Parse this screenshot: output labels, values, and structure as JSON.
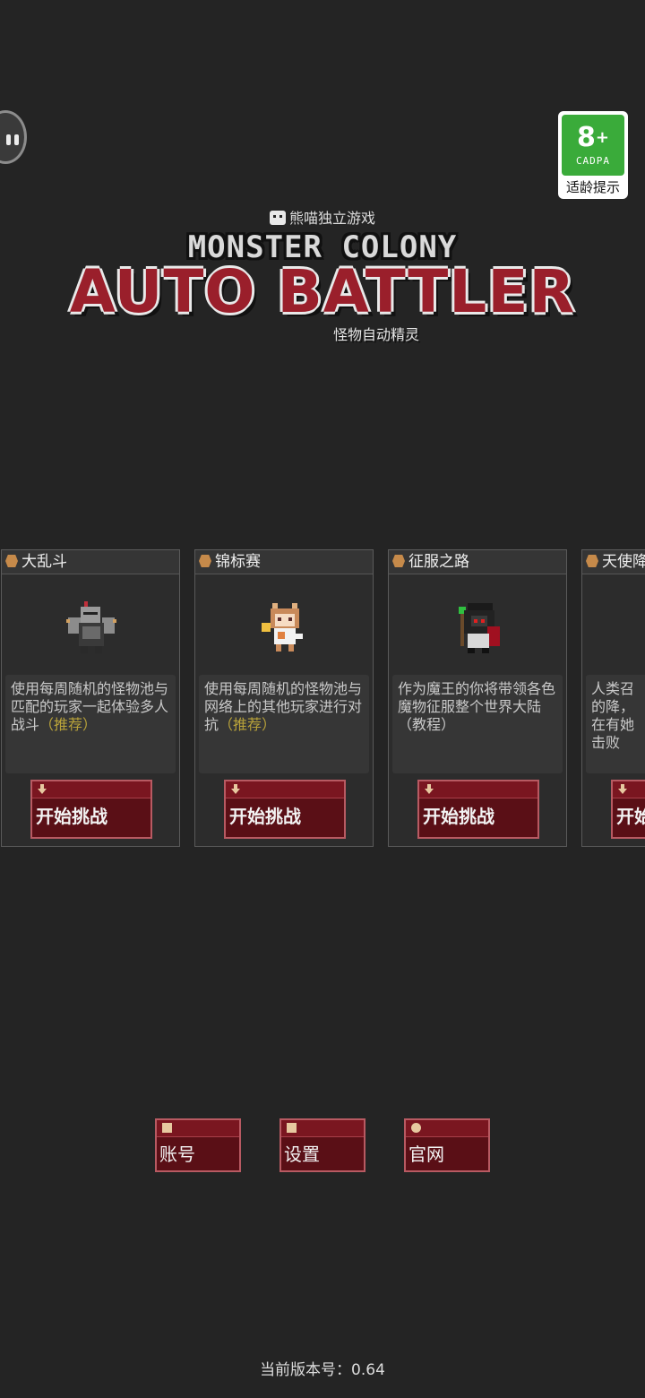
{
  "header": {
    "age_rating": {
      "number": "8",
      "plus": "+",
      "org": "CADPA",
      "tip": "适龄提示",
      "color": "#3aab3a"
    }
  },
  "logo": {
    "studio": "熊喵独立游戏",
    "line1": "MONSTER COLONY",
    "line2": "AUTO BATTLER",
    "subtitle": "怪物自动精灵"
  },
  "modes": [
    {
      "title": "大乱斗",
      "icon": "helmet-icon",
      "sprite": "armored-knight",
      "desc": "使用每周随机的怪物池与匹配的玩家一起体验多人战斗",
      "tag": "（推荐）",
      "button": "开始挑战"
    },
    {
      "title": "锦标赛",
      "icon": "trophy-icon",
      "sprite": "cat-girl",
      "desc": "使用每周随机的怪物池与网络上的其他玩家进行对抗",
      "tag": "（推荐）",
      "button": "开始挑战"
    },
    {
      "title": "征服之路",
      "icon": "tower-icon",
      "sprite": "demon-lord",
      "desc": "作为魔王的你将带领各色魔物征服整个世界大陆（教程）",
      "tag": "",
      "button": "开始挑战"
    },
    {
      "title": "天使降",
      "icon": "cross-icon",
      "sprite": "angel",
      "desc": "人类召的降，在有她击败",
      "tag": "",
      "button": "开始"
    }
  ],
  "menu": {
    "account": "账号",
    "settings": "设置",
    "website": "官网"
  },
  "footer": {
    "version": "当前版本号：0.64"
  },
  "colors": {
    "button_bg": "#5a0f16",
    "button_border": "#b85a62",
    "recommend": "#b8a23a",
    "background": "#242424"
  }
}
